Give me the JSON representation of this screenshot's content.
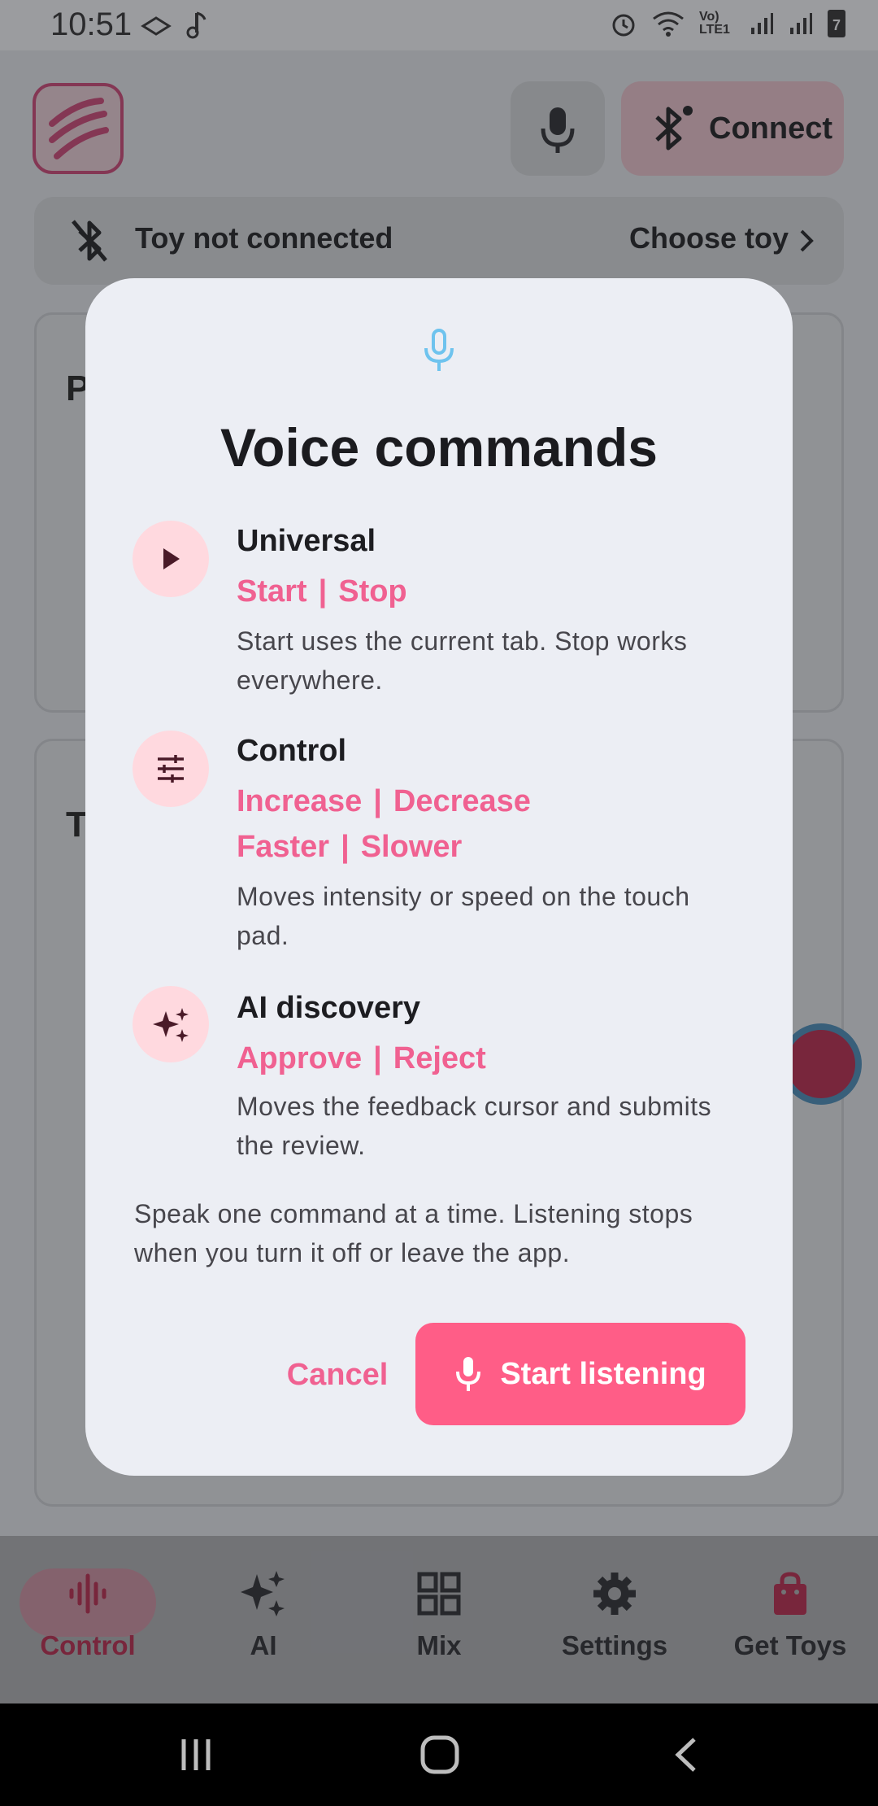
{
  "status_bar": {
    "time": "10:51",
    "network_label": "Vo) LTE1",
    "battery_level": "7"
  },
  "header": {
    "connect_label": "Connect"
  },
  "toy_bar": {
    "status": "Toy not connected",
    "choose": "Choose toy"
  },
  "background": {
    "card1_letter": "P",
    "card2_letter": "T"
  },
  "dialog": {
    "title": "Voice commands",
    "sections": [
      {
        "title": "Universal",
        "icon": "play-icon",
        "commands": [
          "Start",
          "Stop"
        ],
        "description": "Start uses the current tab. Stop works everywhere."
      },
      {
        "title": "Control",
        "icon": "sliders-icon",
        "commands_row1": [
          "Increase",
          "Decrease"
        ],
        "commands_row2": [
          "Faster",
          "Slower"
        ],
        "description": "Moves intensity or speed on the touch pad."
      },
      {
        "title": "AI discovery",
        "icon": "sparkle-icon",
        "commands": [
          "Approve",
          "Reject"
        ],
        "description": "Moves the feedback cursor and submits the review."
      }
    ],
    "footnote": "Speak one command at a time. Listening stops when you turn it off or leave the app.",
    "cancel_label": "Cancel",
    "start_label": "Start listening",
    "separator": "|"
  },
  "bottom_nav": {
    "items": [
      {
        "label": "Control",
        "icon": "waveform-icon",
        "active": true
      },
      {
        "label": "AI",
        "icon": "sparkle-icon"
      },
      {
        "label": "Mix",
        "icon": "grid-icon"
      },
      {
        "label": "Settings",
        "icon": "gear-icon"
      },
      {
        "label": "Get Toys",
        "icon": "shopping-bag-icon"
      }
    ]
  },
  "colors": {
    "accent": "#ff5d87",
    "accent_text": "#f06191",
    "dialog_bg": "#eceef4"
  }
}
